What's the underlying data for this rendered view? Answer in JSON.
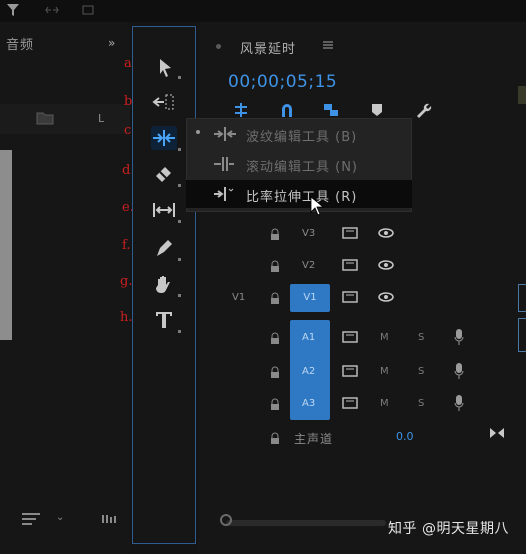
{
  "left_panel": {
    "title": "音频",
    "chevron": "»",
    "list_marker": "L",
    "bottom_chevron": "⌄"
  },
  "annotations": [
    "a.",
    "b.",
    "c.",
    "d.",
    "e.",
    "f.",
    "g.",
    "h."
  ],
  "tools": [
    {
      "id": "selection",
      "icon": "arrow-icon"
    },
    {
      "id": "track-select",
      "icon": "track-select-forward-icon"
    },
    {
      "id": "ripple-edit",
      "icon": "ripple-edit-icon",
      "active": true
    },
    {
      "id": "razor",
      "icon": "razor-icon"
    },
    {
      "id": "slip",
      "icon": "slip-icon"
    },
    {
      "id": "pen",
      "icon": "pen-icon"
    },
    {
      "id": "hand",
      "icon": "hand-icon"
    },
    {
      "id": "type",
      "icon": "type-icon",
      "glyph": "T"
    }
  ],
  "sequence": {
    "title": "风景延时",
    "timecode": "00;00;05;15"
  },
  "flyout": {
    "items": [
      {
        "label": "波纹编辑工具 (B)",
        "icon": "ripple-edit-icon"
      },
      {
        "label": "滚动编辑工具 (N)",
        "icon": "rolling-edit-icon"
      },
      {
        "label": "比率拉伸工具 (R)",
        "icon": "rate-stretch-icon",
        "highlighted": true
      }
    ]
  },
  "tracks": {
    "video": [
      {
        "label": "V3",
        "target": false
      },
      {
        "label": "V2",
        "target": false
      },
      {
        "label": "V1",
        "target": true,
        "source": "V1"
      }
    ],
    "audio": [
      {
        "label": "A1",
        "m": "M",
        "s": "S"
      },
      {
        "label": "A2",
        "m": "M",
        "s": "S"
      },
      {
        "label": "A3",
        "m": "M",
        "s": "S"
      }
    ],
    "master": {
      "label": "主声道",
      "value": "0.0"
    }
  },
  "watermark": "知乎 @明天星期八",
  "colors": {
    "accent_blue": "#3f93e6",
    "track_target": "#2f78c4",
    "annotation_red": "#cc1f1f",
    "panel_border": "#2f5d8f"
  }
}
